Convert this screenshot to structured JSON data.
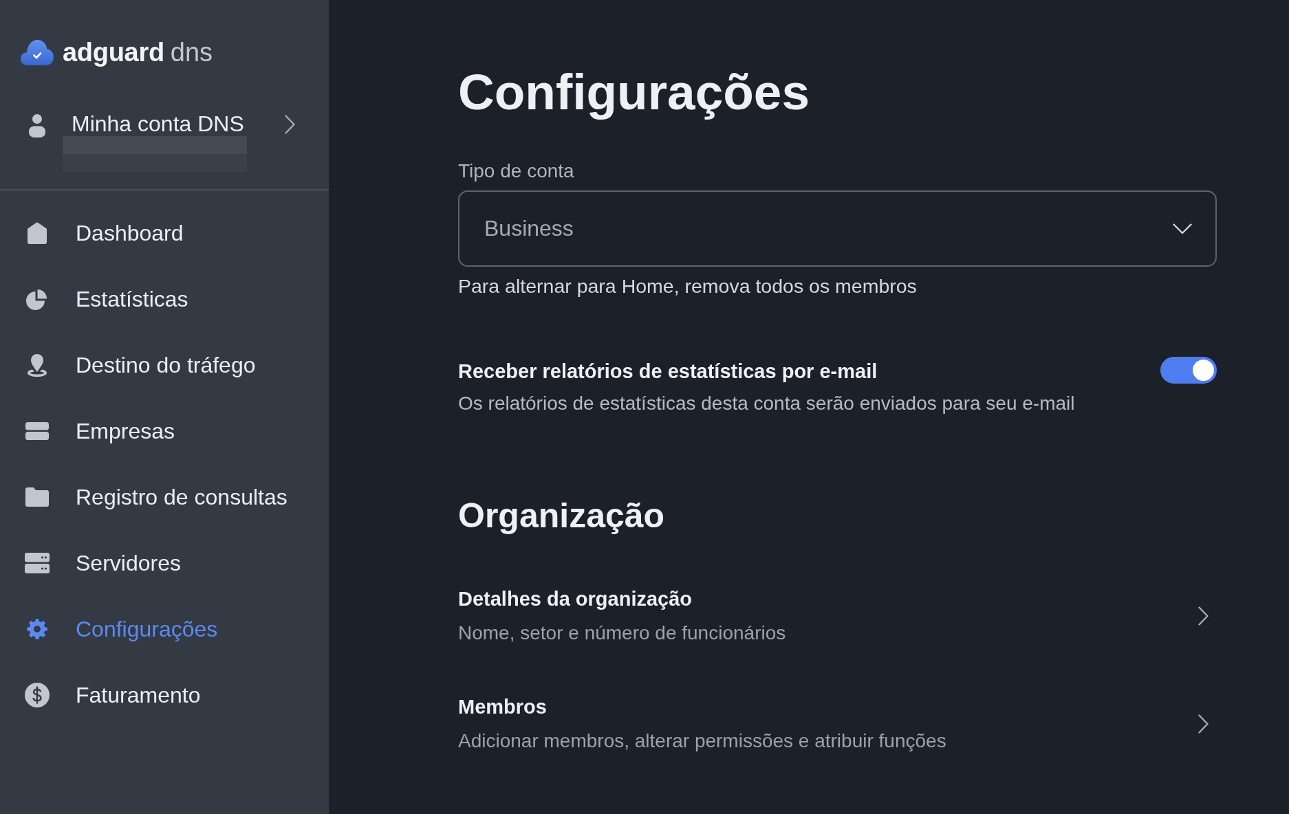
{
  "sidebar": {
    "logo": {
      "brand": "adguard",
      "product": "dns"
    },
    "account": {
      "label": "Minha conta DNS"
    },
    "items": [
      {
        "label": "Dashboard",
        "kind": "home",
        "selected": false
      },
      {
        "label": "Estatísticas",
        "kind": "chart",
        "selected": false
      },
      {
        "label": "Destino do tráfego",
        "kind": "pin",
        "selected": false
      },
      {
        "label": "Empresas",
        "kind": "stack",
        "selected": false
      },
      {
        "label": "Registro de consultas",
        "kind": "folder",
        "selected": false
      },
      {
        "label": "Servidores",
        "kind": "server",
        "selected": false
      },
      {
        "label": "Configurações",
        "kind": "gear",
        "selected": true
      },
      {
        "label": "Faturamento",
        "kind": "dollar",
        "selected": false
      }
    ]
  },
  "main": {
    "title": "Configurações",
    "account_type": {
      "label": "Tipo de conta",
      "value": "Business",
      "hint": "Para alternar para Home, remova todos os membros"
    },
    "email_reports": {
      "title": "Receber relatórios de estatísticas por e-mail",
      "description": "Os relatórios de estatísticas desta conta serão enviados para seu e-mail",
      "on": true
    },
    "organization": {
      "title": "Organização",
      "rows": [
        {
          "title": "Detalhes da organização",
          "description": "Nome, setor e número de funcionários"
        },
        {
          "title": "Membros",
          "description": "Adicionar membros, alterar permissões e atribuir funções"
        }
      ]
    }
  }
}
